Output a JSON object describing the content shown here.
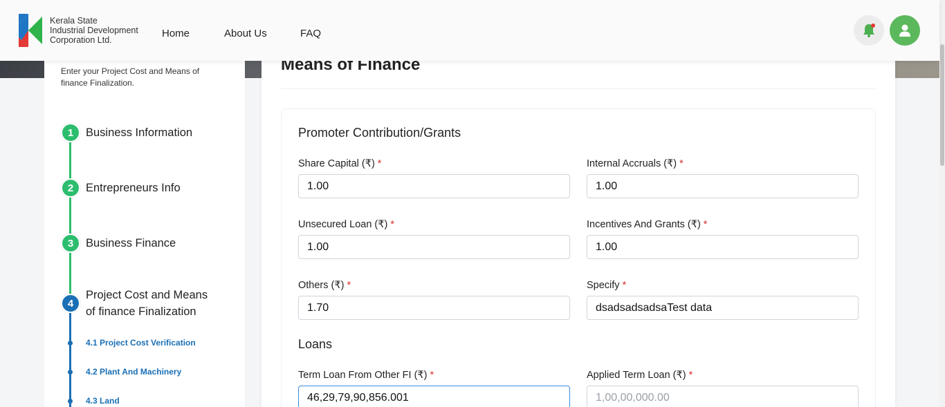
{
  "header": {
    "brand_line1": "Kerala State",
    "brand_line2": "Industrial Development",
    "brand_line3": "Corporation Ltd.",
    "nav": [
      "Home",
      "About Us",
      "FAQ"
    ]
  },
  "sidebar": {
    "intro": "Enter your Project Cost and Means of finance Finalization.",
    "steps": [
      {
        "number": "1",
        "label": "Business Information",
        "status": "completed"
      },
      {
        "number": "2",
        "label": "Entrepreneurs Info",
        "status": "completed"
      },
      {
        "number": "3",
        "label": "Business Finance",
        "status": "completed"
      },
      {
        "number": "4",
        "label_line1": "Project Cost and Means",
        "label_line2": "of finance Finalization",
        "status": "active"
      }
    ],
    "substeps": [
      "4.1 Project Cost Verification",
      "4.2 Plant And Machinery",
      "4.3 Land"
    ]
  },
  "main": {
    "title": "Means of Finance",
    "section1": "Promoter Contribution/Grants",
    "section2": "Loans",
    "required_marker": "*",
    "fields": {
      "share_capital": {
        "label": "Share Capital (₹)",
        "value": "1.00"
      },
      "internal_accruals": {
        "label": "Internal Accruals (₹)",
        "value": "1.00"
      },
      "unsecured_loan": {
        "label": "Unsecured Loan (₹)",
        "value": "1.00"
      },
      "incentives_grants": {
        "label": "Incentives And Grants (₹)",
        "value": "1.00"
      },
      "others": {
        "label": "Others (₹)",
        "value": "1.70"
      },
      "specify": {
        "label": "Specify",
        "value": "dsadsadsadsaTest data"
      },
      "term_loan_other_fi": {
        "label": "Term Loan From Other FI (₹)",
        "value": "46,29,79,90,856.001"
      },
      "applied_term_loan": {
        "label": "Applied Term Loan (₹)",
        "placeholder": "1,00,00,000.00"
      }
    }
  },
  "colors": {
    "completed": "#2dbd6e",
    "active": "#1a6fb5",
    "required": "#d9302c",
    "avatar": "#5cb85c"
  }
}
